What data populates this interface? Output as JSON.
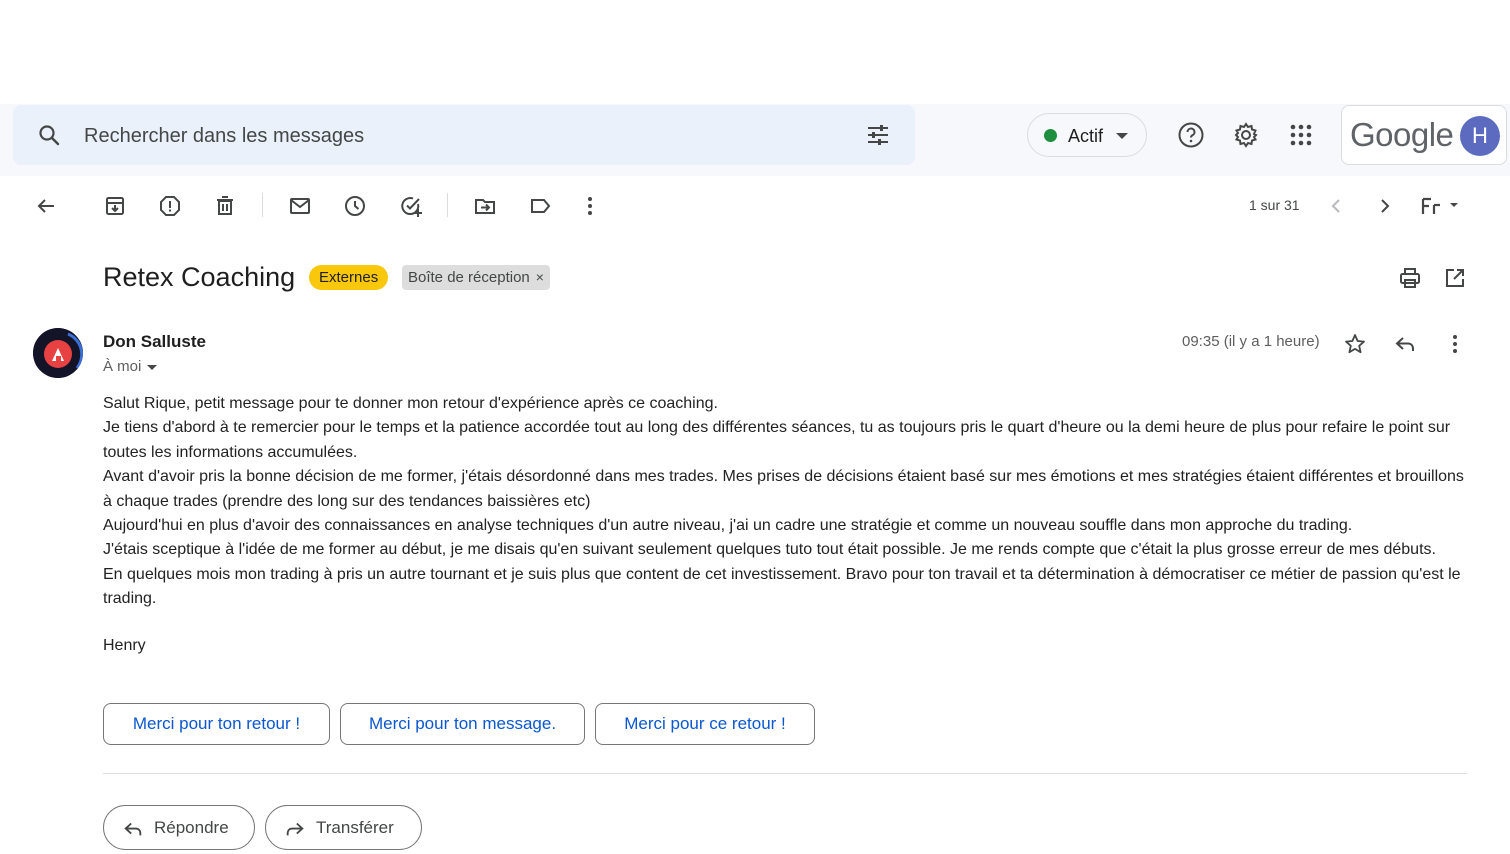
{
  "search": {
    "placeholder": "Rechercher dans les messages"
  },
  "status": {
    "label": "Actif",
    "color": "#1e8e3e"
  },
  "brand": {
    "google_word": "Google",
    "avatar_letter": "H",
    "avatar_color": "#5c6bc0"
  },
  "toolbar": {
    "pager": "1 sur 31"
  },
  "email": {
    "subject": "Retex Coaching",
    "labels": [
      "Externes",
      "Boîte de réception"
    ],
    "label_remove": "×",
    "sender": "Don Salluste",
    "recipient": "À moi",
    "time": "09:35 (il y a 1 heure)",
    "body": [
      "Salut Rique, petit message pour te donner mon retour d'expérience après ce coaching.",
      "Je tiens d'abord à te remercier pour le temps et la patience accordée tout au long des différentes séances, tu as toujours pris le quart d'heure ou la demi heure de plus pour refaire le point sur toutes les informations accumulées.",
      "Avant d'avoir pris la bonne décision de me former, j'étais désordonné dans mes trades. Mes prises de décisions étaient basé sur mes émotions et mes stratégies étaient différentes et brouillons à chaque trades (prendre des long sur des tendances baissières etc)",
      "Aujourd'hui en plus d'avoir des connaissances en analyse techniques d'un autre niveau, j'ai un cadre une stratégie et comme un nouveau souffle dans mon approche du trading.",
      "J'étais sceptique à l'idée de me former au début, je me disais qu'en suivant seulement quelques tuto tout était possible. Je me rends compte que c'était la plus grosse erreur de mes débuts.",
      "En quelques mois mon trading à pris un autre tournant et je suis plus que content de cet investissement. Bravo pour ton travail et ta détermination à démocratiser ce métier de passion qu'est le trading."
    ],
    "signature": "Henry"
  },
  "smart_replies": [
    "Merci pour ton retour !",
    "Merci pour ton message.",
    "Merci pour ce retour !"
  ],
  "actions": {
    "reply": "Répondre",
    "forward": "Transférer"
  },
  "colors": {
    "accent": "#0b57d0",
    "label_externes": "#f9c70c",
    "label_inbox": "#dddddd"
  }
}
